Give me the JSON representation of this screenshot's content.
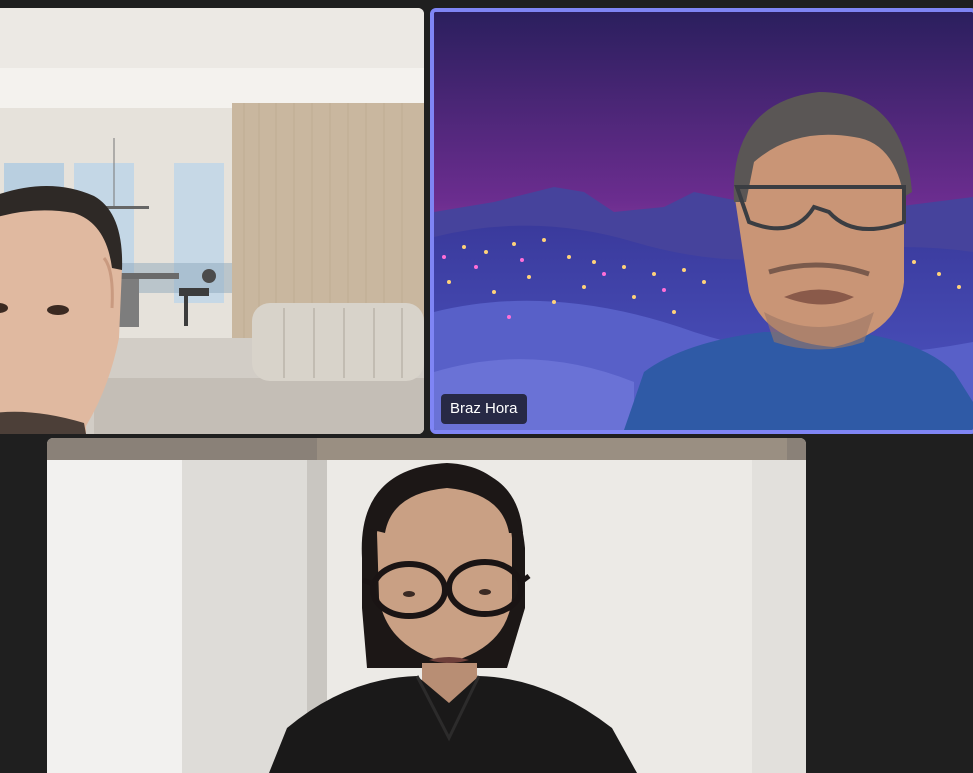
{
  "participants": [
    {
      "id": "p1",
      "name": "",
      "background": "modern-living-room",
      "active_speaker": false
    },
    {
      "id": "p2",
      "name": "Braz Hora",
      "background": "purple-mountain-landscape",
      "active_speaker": true
    },
    {
      "id": "p3",
      "name": "",
      "background": "white-wall-room",
      "active_speaker": false
    }
  ],
  "colors": {
    "stage_background": "#1f1f1f",
    "active_speaker_border": "#7f85f5",
    "name_badge_background": "#14141c",
    "name_badge_text": "#ffffff"
  }
}
